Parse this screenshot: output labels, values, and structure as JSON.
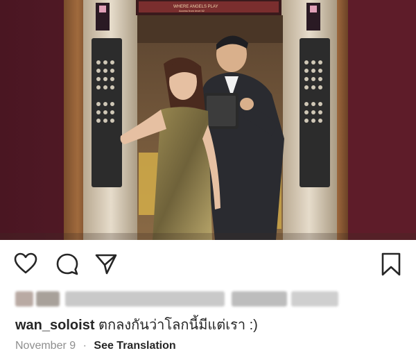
{
  "post": {
    "image": {
      "alt": "Photo of couple taking a mirror selfie in an elevator",
      "sign_text": "WHERE ANGELS PLAY",
      "sign_subtext": "Access from level 52"
    },
    "icons": {
      "like": "heart-icon",
      "comment": "comment-bubble-icon",
      "share": "paper-plane-icon",
      "save": "bookmark-icon"
    },
    "likes_blurred": true,
    "caption": {
      "username": "wan_soloist",
      "text": "ตกลงกันว่าโลกนี้มีแต่เรา :)"
    },
    "date": "November 9",
    "see_translation": "See Translation"
  },
  "colors": {
    "text": "#262626",
    "muted": "#8e8e8e",
    "wall": "#5a1f2b"
  }
}
